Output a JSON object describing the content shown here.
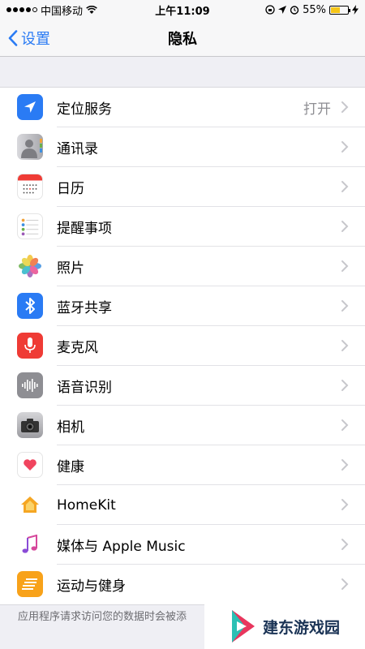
{
  "status_bar": {
    "carrier": "中国移动",
    "time": "上午11:09",
    "battery": "55%",
    "battery_level": 0.55
  },
  "nav": {
    "back_label": "设置",
    "title": "隐私"
  },
  "rows": [
    {
      "label": "定位服务",
      "value": "打开",
      "icon": "location-arrow-icon",
      "color": "#2a7bf4"
    },
    {
      "label": "通讯录",
      "value": "",
      "icon": "contacts-icon",
      "color": "#b8b8bd"
    },
    {
      "label": "日历",
      "value": "",
      "icon": "calendar-icon",
      "color": "#ffffff"
    },
    {
      "label": "提醒事项",
      "value": "",
      "icon": "reminders-icon",
      "color": "#ffffff"
    },
    {
      "label": "照片",
      "value": "",
      "icon": "photos-icon",
      "color": "#ffffff"
    },
    {
      "label": "蓝牙共享",
      "value": "",
      "icon": "bluetooth-icon",
      "color": "#2a7bf4"
    },
    {
      "label": "麦克风",
      "value": "",
      "icon": "microphone-icon",
      "color": "#ef3b35"
    },
    {
      "label": "语音识别",
      "value": "",
      "icon": "waveform-icon",
      "color": "#8e8e93"
    },
    {
      "label": "相机",
      "value": "",
      "icon": "camera-icon",
      "color": "#5b5b60"
    },
    {
      "label": "健康",
      "value": "",
      "icon": "health-heart-icon",
      "color": "#ffffff"
    },
    {
      "label": "HomeKit",
      "value": "",
      "icon": "home-icon",
      "color": "#ffffff"
    },
    {
      "label": "媒体与 Apple Music",
      "value": "",
      "icon": "music-note-icon",
      "color": "#ffffff"
    },
    {
      "label": "运动与健身",
      "value": "",
      "icon": "motion-icon",
      "color": "#f8a21a"
    }
  ],
  "footer": {
    "text": "应用程序请求访问您的数据时会被添"
  },
  "watermark": {
    "text": "建东游戏园"
  }
}
